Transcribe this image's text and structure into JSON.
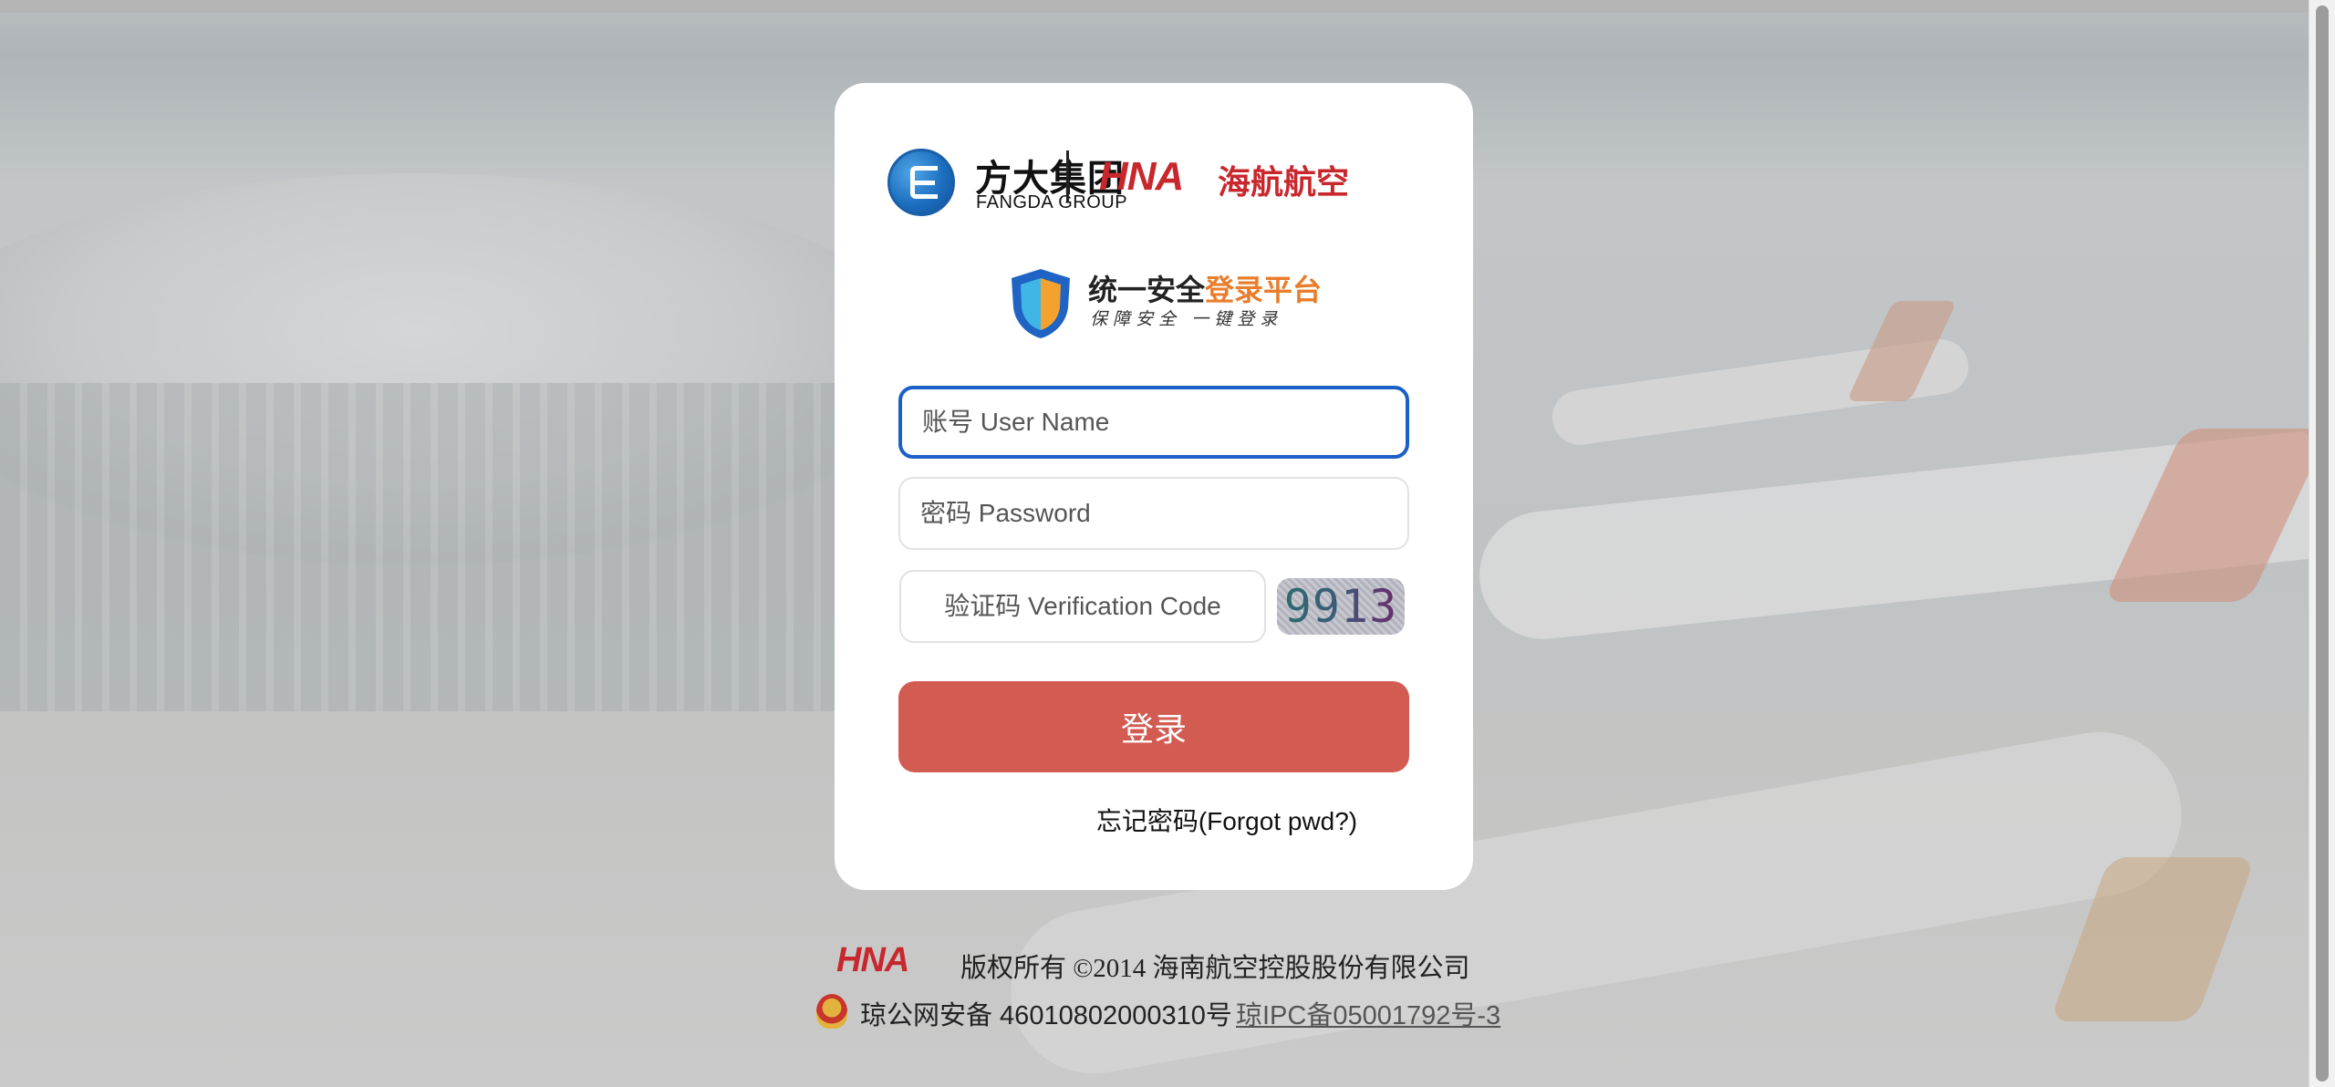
{
  "brand": {
    "group_cn": "方大集团",
    "group_en": "FANGDA GROUP",
    "airline_mark": "HNA",
    "airline_cn": "海航航空"
  },
  "platform": {
    "title_part1": "统一安全",
    "title_part2": "登录平台",
    "subtitle": "保障安全  一键登录",
    "shield_icon": "shield-icon"
  },
  "form": {
    "username_placeholder": "账号 User Name",
    "username_value": "",
    "password_placeholder": "密码 Password",
    "password_value": "",
    "captcha_placeholder": "验证码 Verification Code",
    "captcha_value": "",
    "captcha_image_text": "9913",
    "login_label": "登录",
    "forgot_label": "忘记密码(Forgot pwd?)"
  },
  "footer": {
    "logo": "HNA",
    "copyright": "版权所有 ©2014 海南航空控股股份有限公司",
    "beian": "琼公网安备 46010802000310号",
    "icp": "琼IPC备05001792号-3"
  },
  "colors": {
    "login_button": "#d25b52",
    "focus_border": "#1b5fc8",
    "hna_red": "#c8282d",
    "highlight_orange": "#e97d2b"
  }
}
